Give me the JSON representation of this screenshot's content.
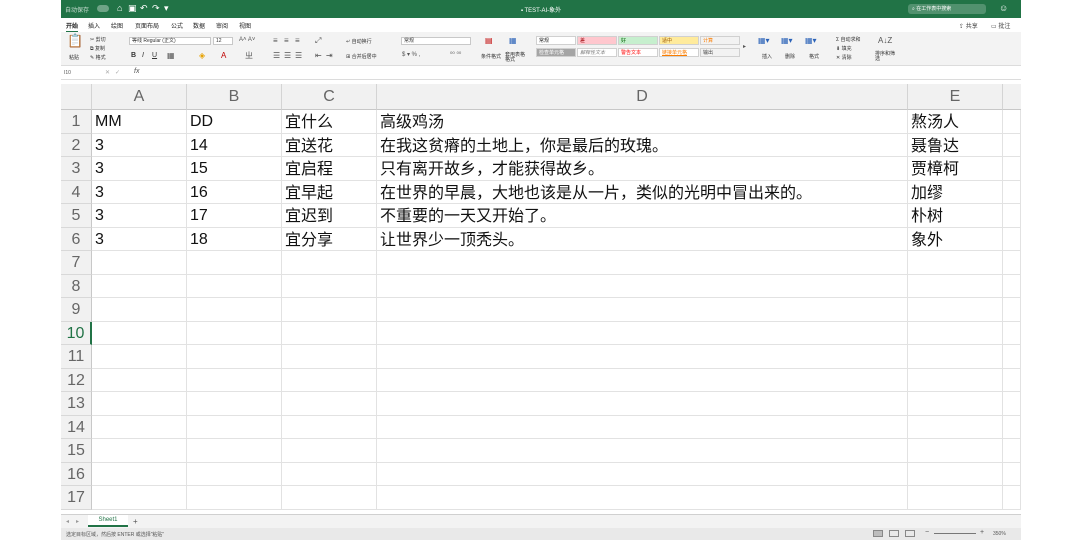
{
  "titlebar": {
    "autosave_label": "自动保存",
    "toggle_label": "关闭",
    "title": "TEST-AI-象外",
    "search_placeholder": "在工作表中搜索"
  },
  "tabs": [
    {
      "label": "开始",
      "active": true
    },
    {
      "label": "插入"
    },
    {
      "label": "绘图"
    },
    {
      "label": "页面布局"
    },
    {
      "label": "公式"
    },
    {
      "label": "数据"
    },
    {
      "label": "审阅"
    },
    {
      "label": "视图"
    }
  ],
  "tabs_right": {
    "share": "共享",
    "comments": "批注"
  },
  "ribbon": {
    "paste": "粘贴",
    "cut": "剪切",
    "copy": "复制",
    "format_painter": "格式",
    "font_name": "等线 Regular (正文)",
    "font_size": "12",
    "wrap_text": "自动换行",
    "merge_center": "合并后居中",
    "number_format": "常规",
    "conditional_format": "条件格式",
    "format_as_table": "套用表格格式",
    "styles": [
      {
        "label": "常规",
        "bg": "#ffffff",
        "fg": "#222222"
      },
      {
        "label": "差",
        "bg": "#ffc7ce",
        "fg": "#9c0006"
      },
      {
        "label": "好",
        "bg": "#c6efce",
        "fg": "#006100"
      },
      {
        "label": "适中",
        "bg": "#ffeb9c",
        "fg": "#9c5700"
      },
      {
        "label": "计算",
        "bg": "#f2f2f2",
        "fg": "#fa7d00"
      },
      {
        "label": "检查单元格",
        "bg": "#a5a5a5",
        "fg": "#ffffff"
      },
      {
        "label": "解释性文本",
        "bg": "#ffffff",
        "fg": "#7f7f7f"
      },
      {
        "label": "警告文本",
        "bg": "#ffffff",
        "fg": "#ff0000"
      },
      {
        "label": "链接单元格",
        "bg": "#ffffff",
        "fg": "#fa7d00"
      },
      {
        "label": "输出",
        "bg": "#f2f2f2",
        "fg": "#3f3f3f"
      }
    ],
    "insert": "插入",
    "delete": "删除",
    "format": "格式",
    "autosum": "自动求和",
    "fill": "填充",
    "clear": "清除",
    "sort_filter": "排序和筛选"
  },
  "formula_bar": {
    "name_box": "I10",
    "fx": "fx",
    "content": ""
  },
  "columns": [
    "A",
    "B",
    "C",
    "D",
    "E"
  ],
  "rows": [
    {
      "num": "1",
      "cells": [
        "MM",
        "DD",
        "宜什么",
        "高级鸡汤",
        "熬汤人"
      ]
    },
    {
      "num": "2",
      "cells": [
        "3",
        "14",
        "宜送花",
        "在我这贫瘠的土地上，你是最后的玫瑰。",
        "聂鲁达"
      ]
    },
    {
      "num": "3",
      "cells": [
        "3",
        "15",
        "宜启程",
        "只有离开故乡，才能获得故乡。",
        "贾樟柯"
      ]
    },
    {
      "num": "4",
      "cells": [
        "3",
        "16",
        "宜早起",
        "在世界的早晨，大地也该是从一片，类似的光明中冒出来的。",
        "加缪"
      ]
    },
    {
      "num": "5",
      "cells": [
        "3",
        "17",
        "宜迟到",
        "不重要的一天又开始了。",
        "朴树"
      ]
    },
    {
      "num": "6",
      "cells": [
        "3",
        "18",
        "宜分享",
        "让世界少一顶秃头。",
        "象外"
      ]
    },
    {
      "num": "7",
      "cells": [
        "",
        "",
        "",
        "",
        ""
      ]
    },
    {
      "num": "8",
      "cells": [
        "",
        "",
        "",
        "",
        ""
      ]
    },
    {
      "num": "9",
      "cells": [
        "",
        "",
        "",
        "",
        ""
      ]
    },
    {
      "num": "10",
      "cells": [
        "",
        "",
        "",
        "",
        ""
      ],
      "active": true
    },
    {
      "num": "11",
      "cells": [
        "",
        "",
        "",
        "",
        ""
      ]
    },
    {
      "num": "12",
      "cells": [
        "",
        "",
        "",
        "",
        ""
      ]
    },
    {
      "num": "13",
      "cells": [
        "",
        "",
        "",
        "",
        ""
      ]
    },
    {
      "num": "14",
      "cells": [
        "",
        "",
        "",
        "",
        ""
      ]
    },
    {
      "num": "15",
      "cells": [
        "",
        "",
        "",
        "",
        ""
      ]
    },
    {
      "num": "16",
      "cells": [
        "",
        "",
        "",
        "",
        ""
      ]
    },
    {
      "num": "17",
      "cells": [
        "",
        "",
        "",
        "",
        ""
      ]
    }
  ],
  "sheet": {
    "name": "Sheet1",
    "add": "+"
  },
  "status": {
    "message": "选定目标区域，然后按 ENTER 或选择“粘贴”",
    "zoom": "350%"
  },
  "colors": {
    "accent": "#217346",
    "titlebar": "#217346"
  }
}
